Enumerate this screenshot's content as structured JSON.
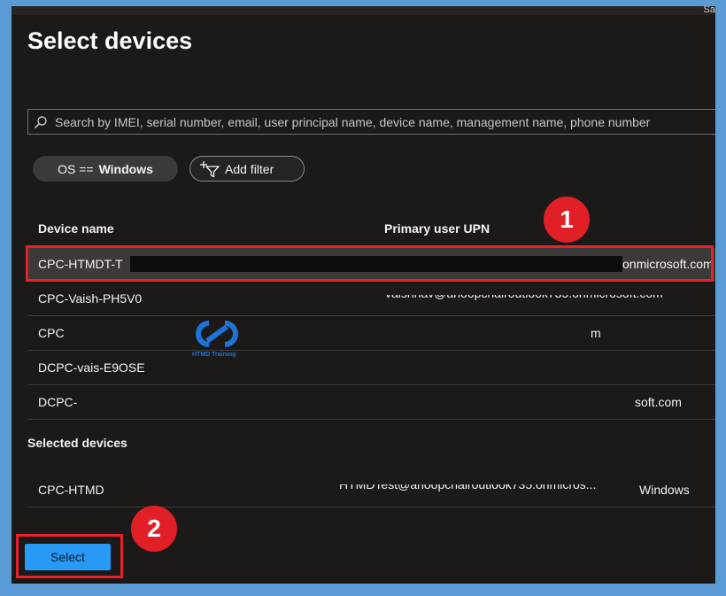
{
  "header": {
    "title": "Select devices",
    "corner_text": "Sa"
  },
  "search": {
    "placeholder": "Search by IMEI, serial number, email, user principal name, device name, management name, phone number"
  },
  "filters": {
    "os_label": "OS ==",
    "os_value": "Windows",
    "add_filter_label": "Add filter"
  },
  "table": {
    "headers": [
      "Device name",
      "Primary user UPN"
    ],
    "rows": [
      {
        "device": "CPC-HTMDT-T",
        "upn": "onmicrosoft.com"
      },
      {
        "device": "CPC-Vaish-PH5V0",
        "upn": "vaishnav@anoopcnairoutlook735.onmicrosoft.com"
      },
      {
        "device": "CPC",
        "upn": "m"
      },
      {
        "device": "DCPC-vais-E9OSE",
        "upn": ""
      },
      {
        "device": "DCPC-",
        "upn": "soft.com"
      }
    ]
  },
  "selected": {
    "title": "Selected devices",
    "rows": [
      {
        "device": "CPC-HTMD",
        "upn": "HTMDTest@anoopcnairoutlook735.onmicros...",
        "os": "Windows"
      }
    ]
  },
  "footer": {
    "select_label": "Select"
  },
  "annotations": {
    "badge1": "1",
    "badge2": "2",
    "accent": "#e11f26",
    "button_color": "#2899f5"
  },
  "watermark": {
    "text": "HTMD Training",
    "color": "#1e73d8"
  }
}
